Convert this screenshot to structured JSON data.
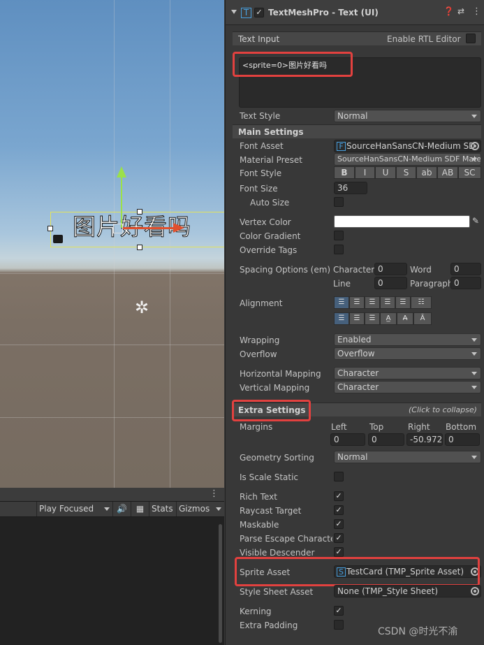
{
  "scene": {
    "display_text": "图片好看吗"
  },
  "game_toolbar": {
    "play_mode": "Play Focused",
    "stats": "Stats",
    "gizmos": "Gizmos"
  },
  "component": {
    "title": "TextMeshPro - Text (UI)"
  },
  "text_input": {
    "header": "Text Input",
    "rtl_label": "Enable RTL Editor",
    "value": "<sprite=0>图片好看吗",
    "text_style_label": "Text Style",
    "text_style": "Normal"
  },
  "main_settings": {
    "header": "Main Settings",
    "font_asset_label": "Font Asset",
    "font_asset": "SourceHanSansCN-Medium SD",
    "material_preset_label": "Material Preset",
    "material_preset": "SourceHanSansCN-Medium SDF Mate",
    "font_style_label": "Font Style",
    "font_styles": [
      "B",
      "I",
      "U",
      "S",
      "ab",
      "AB",
      "SC"
    ],
    "font_size_label": "Font Size",
    "font_size": "36",
    "auto_size_label": "Auto Size",
    "vertex_color_label": "Vertex Color",
    "color_gradient_label": "Color Gradient",
    "override_tags_label": "Override Tags",
    "spacing_label": "Spacing Options (em)",
    "character_label": "Character",
    "character": "0",
    "word_label": "Word",
    "word": "0",
    "line_label": "Line",
    "line": "0",
    "paragraph_label": "Paragraph",
    "paragraph": "0",
    "alignment_label": "Alignment",
    "wrapping_label": "Wrapping",
    "wrapping": "Enabled",
    "overflow_label": "Overflow",
    "overflow": "Overflow",
    "hmap_label": "Horizontal Mapping",
    "hmap": "Character",
    "vmap_label": "Vertical Mapping",
    "vmap": "Character"
  },
  "extra_settings": {
    "header": "Extra Settings",
    "collapse_hint": "(Click to collapse)",
    "margins_label": "Margins",
    "left_label": "Left",
    "top_label": "Top",
    "right_label": "Right",
    "bottom_label": "Bottom",
    "left": "0",
    "top": "0",
    "right": "-50.972",
    "bottom": "0",
    "geometry_sorting_label": "Geometry Sorting",
    "geometry_sorting": "Normal",
    "is_scale_static_label": "Is Scale Static",
    "rich_text_label": "Rich Text",
    "raycast_target_label": "Raycast Target",
    "maskable_label": "Maskable",
    "parse_escape_label": "Parse Escape Characters",
    "visible_descender_label": "Visible Descender",
    "sprite_asset_label": "Sprite Asset",
    "sprite_asset": "TestCard (TMP_Sprite Asset)",
    "style_sheet_label": "Style Sheet Asset",
    "style_sheet": "None (TMP_Style Sheet)",
    "kerning_label": "Kerning",
    "extra_padding_label": "Extra Padding"
  },
  "watermark": "CSDN @时光不渝"
}
